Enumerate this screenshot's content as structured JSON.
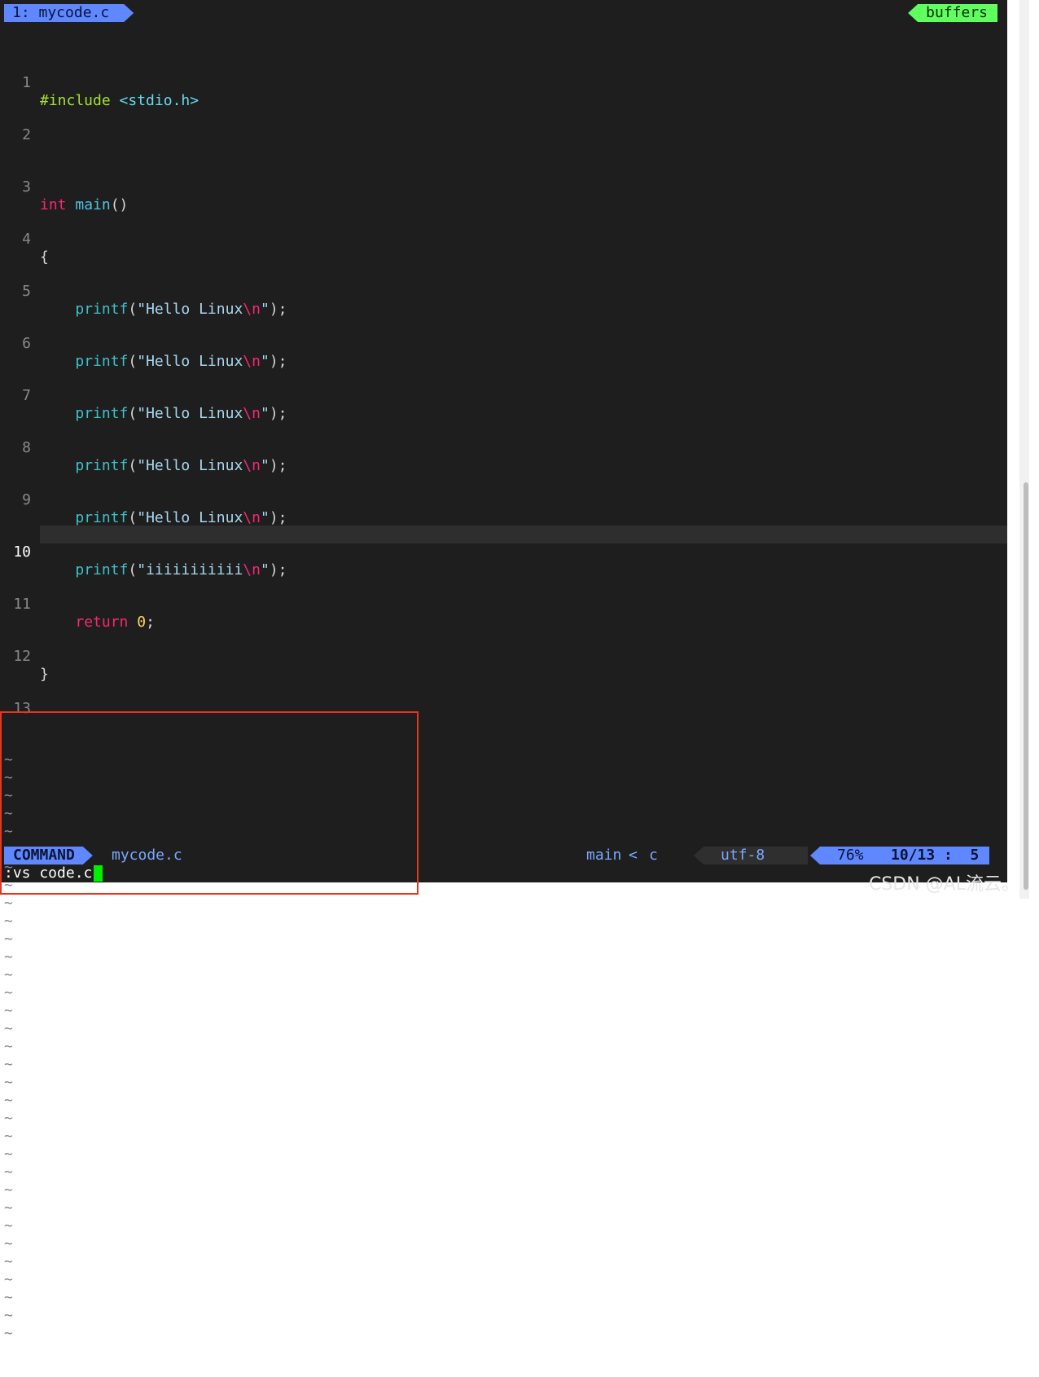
{
  "tabline": {
    "active_tab": "1: mycode.c",
    "right_label": "buffers"
  },
  "code": {
    "line_numbers": [
      "1",
      "2",
      "3",
      "4",
      "5",
      "6",
      "7",
      "8",
      "9",
      "10",
      "11",
      "12",
      "13"
    ],
    "current_line": "10",
    "tilde_char": "~"
  },
  "statusline": {
    "mode": "COMMAND",
    "file": "mycode.c",
    "branch": "main",
    "separator": "<",
    "filetype": "c",
    "encoding": "utf-8",
    "percent": "76%",
    "position": "10/13 :  5"
  },
  "cmdline": {
    "text": ":vs code.c"
  },
  "watermark": "CSDN @AL流云。",
  "colors": {
    "background": "#1e1e1e",
    "mode_blue": "#5f87ff",
    "buffers_green": "#5fff5f",
    "cursor_green": "#00ee00",
    "highlight_red": "#e8361c"
  }
}
